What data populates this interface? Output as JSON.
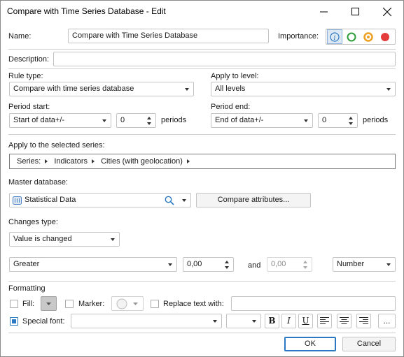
{
  "window": {
    "title": "Compare with Time Series Database - Edit"
  },
  "name": {
    "label": "Name:",
    "value": "Compare with Time Series Database"
  },
  "importance": {
    "label": "Importance:",
    "colors": {
      "blue": "#2b78c2",
      "green": "#2e9e3a",
      "orange": "#f0a020",
      "red": "#e43d3d"
    }
  },
  "description": {
    "label": "Description:",
    "value": ""
  },
  "rule_type": {
    "label": "Rule type:",
    "value": "Compare with time series database"
  },
  "apply_to_level": {
    "label": "Apply to level:",
    "value": "All levels"
  },
  "period_start": {
    "label": "Period start:",
    "value": "Start of data+/-",
    "count": "0",
    "unit": "periods"
  },
  "period_end": {
    "label": "Period end:",
    "value": "End of data+/-",
    "count": "0",
    "unit": "periods"
  },
  "series": {
    "label": "Apply to the selected series:",
    "crumbs": [
      "Series:",
      "Indicators",
      "Cities (with geolocation)"
    ]
  },
  "master_db": {
    "label": "Master database:",
    "value": "Statistical Data",
    "compare_button": "Compare attributes..."
  },
  "changes": {
    "label": "Changes type:",
    "value": "Value is changed"
  },
  "condition": {
    "operator": "Greater",
    "value1": "0,00",
    "and_label": "and",
    "value2": "0,00",
    "type": "Number"
  },
  "formatting": {
    "label": "Formatting",
    "fill_label": "Fill:",
    "marker_label": "Marker:",
    "replace_label": "Replace text with:",
    "replace_value": "",
    "special_font_label": "Special font:",
    "font_name": "",
    "font_size": "",
    "bold": "B",
    "italic": "I",
    "underline": "U",
    "more": "..."
  },
  "footer": {
    "ok": "OK",
    "cancel": "Cancel"
  }
}
